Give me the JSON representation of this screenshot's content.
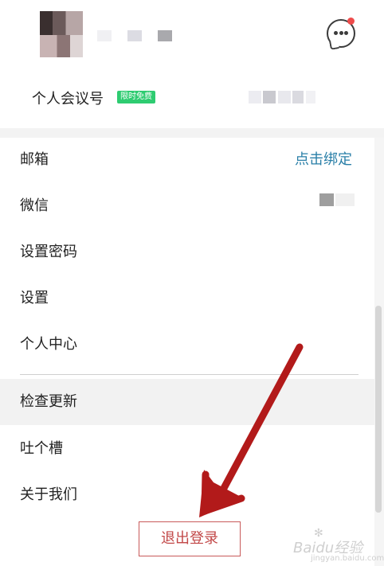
{
  "header": {
    "message_icon": "chat-bubble-icon",
    "badge_color": "#ee4b4b"
  },
  "meeting": {
    "label": "个人会议号",
    "badge": "限时免费"
  },
  "menu": {
    "email_label": "邮箱",
    "email_action": "点击绑定",
    "wechat_label": "微信",
    "set_password_label": "设置密码",
    "settings_label": "设置",
    "personal_center_label": "个人中心",
    "check_update_label": "检查更新",
    "feedback_label": "吐个槽",
    "about_label": "关于我们"
  },
  "footer": {
    "logout_label": "退出登录"
  },
  "watermark": {
    "text": "Baidu经验",
    "sub": "jingyan.baidu.com"
  },
  "colors": {
    "accent_link": "#2a7fa8",
    "free_badge": "#2ecc71",
    "logout": "#c24848",
    "arrow": "#b21a1a"
  }
}
